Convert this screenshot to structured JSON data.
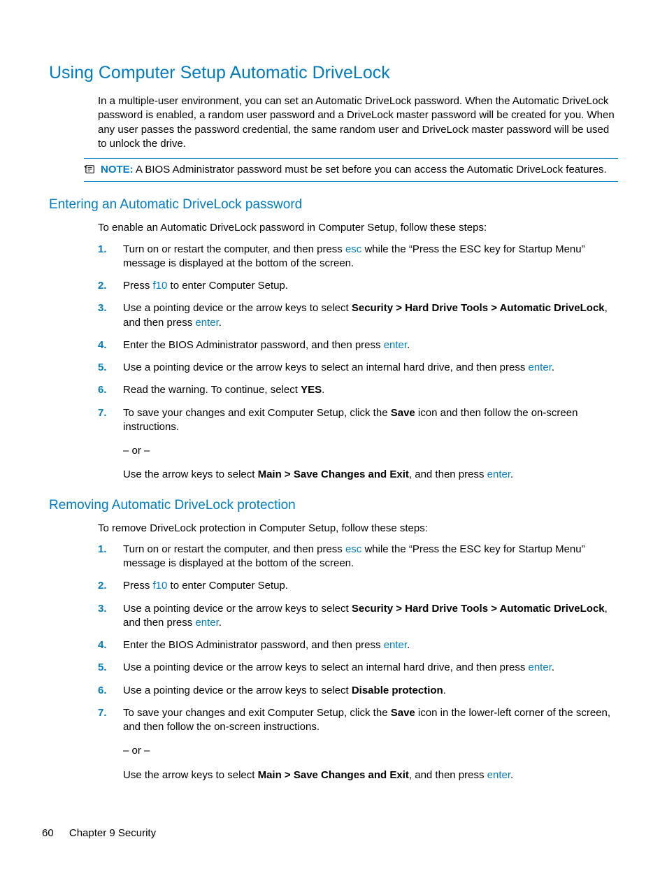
{
  "title": "Using Computer Setup Automatic DriveLock",
  "intro": "In a multiple-user environment, you can set an Automatic DriveLock password. When the Automatic DriveLock password is enabled, a random user password and a DriveLock master password will be created for you. When any user passes the password credential, the same random user and DriveLock master password will be used to unlock the drive.",
  "note_label": "NOTE:",
  "note_text": "A BIOS Administrator password must be set before you can access the Automatic DriveLock features.",
  "section1": {
    "heading": "Entering an Automatic DriveLock password",
    "lead": "To enable an Automatic DriveLock password in Computer Setup, follow these steps:",
    "steps": [
      {
        "num": "1.",
        "pre": "Turn on or restart the computer, and then press ",
        "key": "esc",
        "post": " while the “Press the ESC key for Startup Menu” message is displayed at the bottom of the screen."
      },
      {
        "num": "2.",
        "pre": "Press ",
        "key": "f10",
        "post": " to enter Computer Setup."
      },
      {
        "num": "3.",
        "pre": "Use a pointing device or the arrow keys to select ",
        "bold": "Security > Hard Drive Tools > Automatic DriveLock",
        "post2": ", and then press ",
        "key2": "enter",
        "post3": "."
      },
      {
        "num": "4.",
        "pre": "Enter the BIOS Administrator password, and then press ",
        "key": "enter",
        "post": "."
      },
      {
        "num": "5.",
        "pre": "Use a pointing device or the arrow keys to select an internal hard drive, and then press ",
        "key": "enter",
        "post": "."
      },
      {
        "num": "6.",
        "pre": "Read the warning. To continue, select ",
        "bold": "YES",
        "post": "."
      },
      {
        "num": "7.",
        "pre": "To save your changes and exit Computer Setup, click the ",
        "bold": "Save",
        "post": " icon and then follow the on-screen instructions.",
        "or": "– or –",
        "alt_pre": "Use the arrow keys to select ",
        "alt_bold": "Main > Save Changes and Exit",
        "alt_post": ", and then press ",
        "alt_key": "enter",
        "alt_end": "."
      }
    ]
  },
  "section2": {
    "heading": "Removing Automatic DriveLock protection",
    "lead": "To remove DriveLock protection in Computer Setup, follow these steps:",
    "steps": [
      {
        "num": "1.",
        "pre": "Turn on or restart the computer, and then press ",
        "key": "esc",
        "post": " while the “Press the ESC key for Startup Menu” message is displayed at the bottom of the screen."
      },
      {
        "num": "2.",
        "pre": "Press ",
        "key": "f10",
        "post": " to enter Computer Setup."
      },
      {
        "num": "3.",
        "pre": "Use a pointing device or the arrow keys to select ",
        "bold": "Security > Hard Drive Tools > Automatic DriveLock",
        "post2": ", and then press ",
        "key2": "enter",
        "post3": "."
      },
      {
        "num": "4.",
        "pre": "Enter the BIOS Administrator password, and then press ",
        "key": "enter",
        "post": "."
      },
      {
        "num": "5.",
        "pre": "Use a pointing device or the arrow keys to select an internal hard drive, and then press ",
        "key": "enter",
        "post": "."
      },
      {
        "num": "6.",
        "pre": "Use a pointing device or the arrow keys to select ",
        "bold": "Disable protection",
        "post": "."
      },
      {
        "num": "7.",
        "pre": "To save your changes and exit Computer Setup, click the ",
        "bold": "Save",
        "post": " icon in the lower-left corner of the screen, and then follow the on-screen instructions.",
        "or": "– or –",
        "alt_pre": "Use the arrow keys to select ",
        "alt_bold": "Main > Save Changes and Exit",
        "alt_post": ", and then press ",
        "alt_key": "enter",
        "alt_end": "."
      }
    ]
  },
  "footer": {
    "page_num": "60",
    "chapter": "Chapter 9   Security"
  }
}
